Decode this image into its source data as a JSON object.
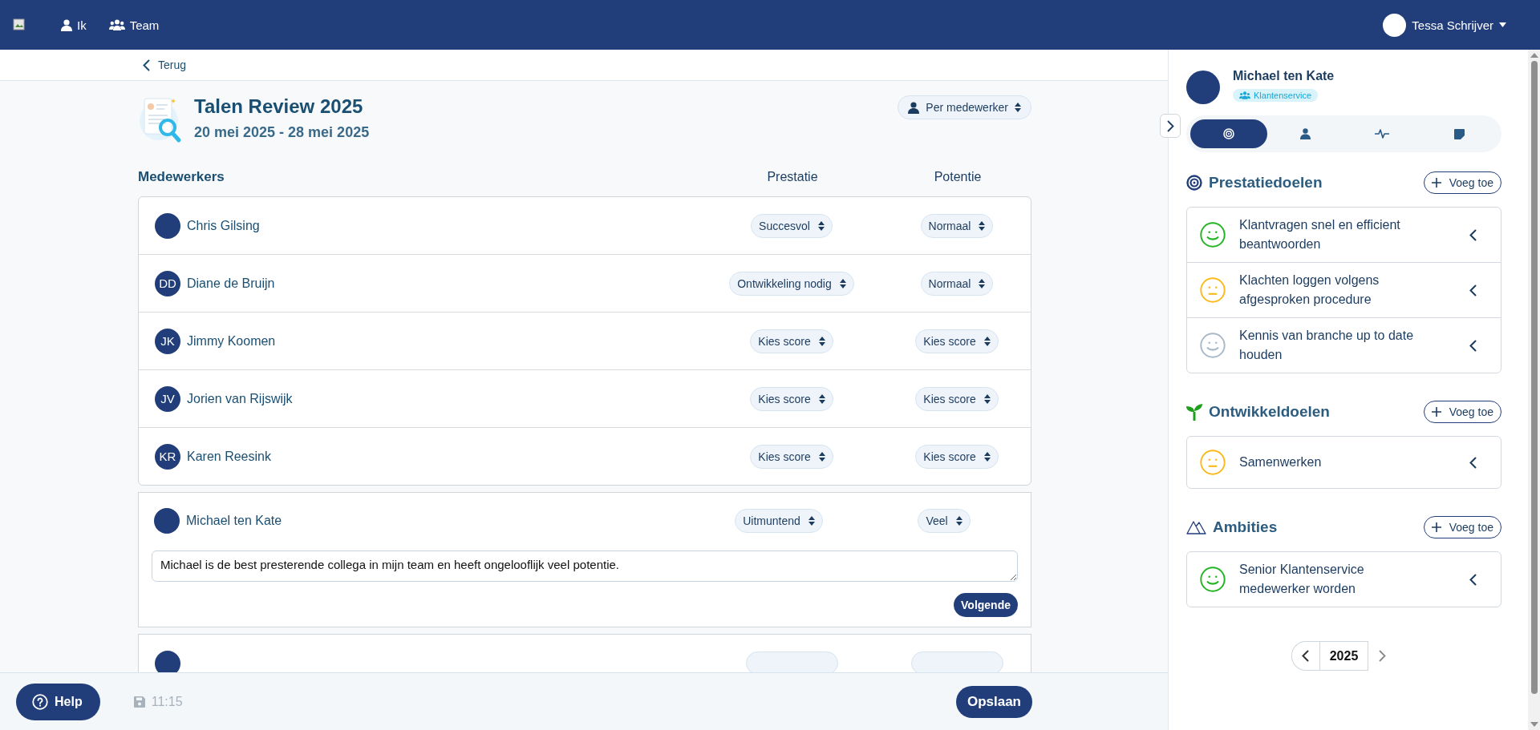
{
  "topbar": {
    "nav": [
      {
        "label": "Ik",
        "kind": "person"
      },
      {
        "label": "Team",
        "kind": "team"
      }
    ],
    "user": "Tessa Schrijver"
  },
  "back": "Terug",
  "review": {
    "title": "Talen Review 2025",
    "dates": "20 mei 2025 - 28 mei 2025",
    "view_select": "Per medewerker"
  },
  "table": {
    "columns": [
      "Medewerkers",
      "Prestatie",
      "Potentie"
    ],
    "rows": [
      {
        "name": "Chris Gilsing",
        "prestatie": "Succesvol",
        "potentie": "Normaal",
        "expanded": false
      },
      {
        "name": "Diane de Bruijn",
        "initials": "DD",
        "prestatie": "Ontwikkeling nodig",
        "potentie": "Normaal",
        "expanded": false
      },
      {
        "name": "Jimmy Koomen",
        "initials": "JK",
        "prestatie": "Kies score",
        "potentie": "Kies score",
        "expanded": false
      },
      {
        "name": "Jorien van Rijswijk",
        "initials": "JV",
        "prestatie": "Kies score",
        "potentie": "Kies score",
        "expanded": false
      },
      {
        "name": "Karen Reesink",
        "initials": "KR",
        "prestatie": "Kies score",
        "potentie": "Kies score",
        "expanded": false
      },
      {
        "name": "Michael ten Kate",
        "prestatie": "Uitmuntend",
        "potentie": "Veel",
        "expanded": true,
        "comment": "Michael is de best presterende collega in mijn team en heeft ongelooflijk veel potentie.",
        "next_button": "Volgende"
      },
      {
        "expanded": false
      }
    ]
  },
  "footer": {
    "help": "Help",
    "saved_time": "11:15",
    "save": "Opslaan"
  },
  "panel": {
    "name": "Michael ten Kate",
    "team": "Klantenservice",
    "tabs": [
      {
        "selected": true
      },
      {
        "selected": false
      },
      {
        "selected": false
      },
      {
        "selected": false
      }
    ],
    "sections": [
      {
        "kind": "performance",
        "title": "Prestatiedoelen",
        "add": "Voeg toe",
        "goals": [
          {
            "text": "Klantvragen snel en efficient beantwoorden",
            "kind": "happy",
            "color": "#22b422"
          },
          {
            "text": "Klachten loggen volgens afgesproken procedure",
            "kind": "neutral",
            "color": "#fbb91c"
          },
          {
            "text": "Kennis van branche up to date houden",
            "kind": "happy",
            "color": "#a9b9c8"
          }
        ]
      },
      {
        "kind": "development",
        "title": "Ontwikkeldoelen",
        "add": "Voeg toe",
        "goals": [
          {
            "text": "Samenwerken",
            "kind": "neutral",
            "color": "#fbb91c"
          }
        ]
      },
      {
        "kind": "ambition",
        "title": "Ambities",
        "add": "Voeg toe",
        "goals": [
          {
            "text": "Senior Klantenservice medewerker worden",
            "kind": "happy",
            "color": "#22b422"
          }
        ]
      }
    ],
    "year": "2025"
  }
}
